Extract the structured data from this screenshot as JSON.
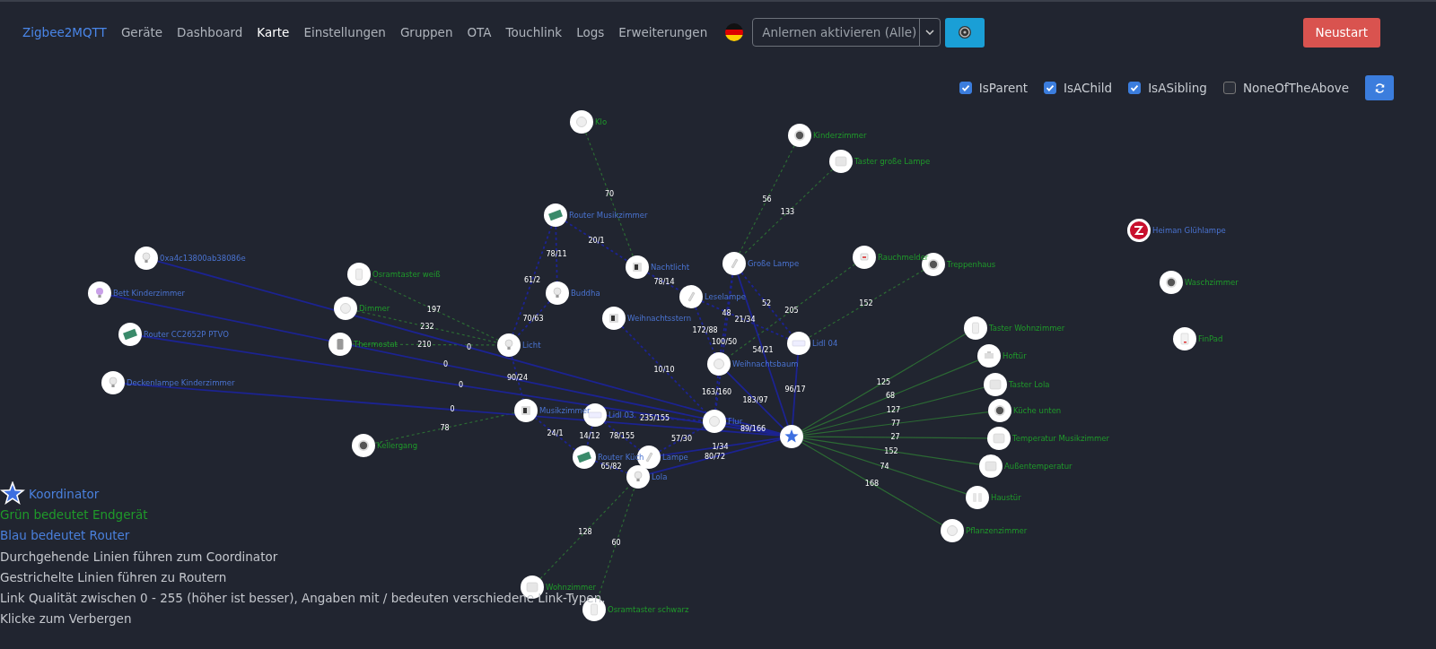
{
  "navbar": {
    "brand": "Zigbee2MQTT",
    "items": [
      {
        "label": "Geräte",
        "selected": false
      },
      {
        "label": "Dashboard",
        "selected": false
      },
      {
        "label": "Karte",
        "selected": true
      },
      {
        "label": "Einstellungen",
        "selected": false
      },
      {
        "label": "Gruppen",
        "selected": false
      },
      {
        "label": "OTA",
        "selected": false
      },
      {
        "label": "Touchlink",
        "selected": false
      },
      {
        "label": "Logs",
        "selected": false
      },
      {
        "label": "Erweiterungen",
        "selected": false
      }
    ],
    "permit_join": {
      "value": "Anlernen aktivieren (Alle)"
    },
    "restart_button": "Neustart"
  },
  "filters": [
    {
      "label": "IsParent",
      "checked": true
    },
    {
      "label": "IsAChild",
      "checked": true
    },
    {
      "label": "IsASibling",
      "checked": true
    },
    {
      "label": "NoneOfTheAbove",
      "checked": false
    }
  ],
  "map": {
    "nodes": [
      {
        "name": "Klo",
        "kind": "end_device"
      },
      {
        "name": "Kinderzimmer",
        "kind": "end_device"
      },
      {
        "name": "Taster große Lampe",
        "kind": "end_device"
      },
      {
        "name": "Router Musikzimmer",
        "kind": "router"
      },
      {
        "name": "Heiman Glühlampe",
        "kind": "router"
      },
      {
        "name": "0xa4c13800ab38086e",
        "kind": "router"
      },
      {
        "name": "Nachtlicht",
        "kind": "router"
      },
      {
        "name": "Große Lampe",
        "kind": "router"
      },
      {
        "name": "Rauchmelder",
        "kind": "end_device"
      },
      {
        "name": "Treppenhaus",
        "kind": "end_device"
      },
      {
        "name": "Osramtaster weiß",
        "kind": "end_device"
      },
      {
        "name": "Waschzimmer",
        "kind": "end_device"
      },
      {
        "name": "Bett Kinderzimmer",
        "kind": "router"
      },
      {
        "name": "Buddha",
        "kind": "router"
      },
      {
        "name": "Leselampe",
        "kind": "router"
      },
      {
        "name": "Dimmer",
        "kind": "end_device"
      },
      {
        "name": "Weihnachtsstern",
        "kind": "router"
      },
      {
        "name": "Router CC2652P PTVO",
        "kind": "router"
      },
      {
        "name": "Thermostat",
        "kind": "end_device"
      },
      {
        "name": "Licht",
        "kind": "router"
      },
      {
        "name": "Lidl 04",
        "kind": "router"
      },
      {
        "name": "Taster Wohnzimmer",
        "kind": "end_device"
      },
      {
        "name": "FinPad",
        "kind": "end_device"
      },
      {
        "name": "Weihnachtsbaum",
        "kind": "router"
      },
      {
        "name": "Hoftür",
        "kind": "end_device"
      },
      {
        "name": "Deckenlampe Kinderzimmer",
        "kind": "router"
      },
      {
        "name": "Taster Lola",
        "kind": "end_device"
      },
      {
        "name": "Musikzimmer",
        "kind": "router"
      },
      {
        "name": "Lidl 03",
        "kind": "router"
      },
      {
        "name": "Flur",
        "kind": "router"
      },
      {
        "name": "Küche unten",
        "kind": "end_device"
      },
      {
        "name": "Kellergang",
        "kind": "end_device"
      },
      {
        "kind": "coordinator"
      },
      {
        "name": "Temperatur Musikzimmer",
        "kind": "end_device"
      },
      {
        "name": "Router Küch",
        "kind": "router"
      },
      {
        "name": "Lampe",
        "kind": "router"
      },
      {
        "name": "Außentemperatur",
        "kind": "end_device"
      },
      {
        "name": "Lola",
        "kind": "router"
      },
      {
        "name": "Haustür",
        "kind": "end_device"
      },
      {
        "name": "Pflanzenzimmer",
        "kind": "end_device"
      },
      {
        "name": "Wohnzimmer",
        "kind": "end_device"
      },
      {
        "name": "Osramtaster schwarz",
        "kind": "end_device"
      }
    ],
    "links": [
      {
        "label": "125"
      },
      {
        "label": "68"
      },
      {
        "label": "127"
      },
      {
        "label": "77"
      },
      {
        "label": "27"
      },
      {
        "label": "152"
      },
      {
        "label": "74"
      },
      {
        "label": "168"
      },
      {
        "label": "70"
      },
      {
        "label": "56"
      },
      {
        "label": "133"
      },
      {
        "label": "205"
      },
      {
        "label": "152"
      },
      {
        "label": "197"
      },
      {
        "label": "232"
      },
      {
        "label": "210"
      },
      {
        "label": "78"
      },
      {
        "label": "128"
      },
      {
        "label": "60"
      },
      {
        "label": "0"
      },
      {
        "label": "0"
      },
      {
        "label": "0"
      },
      {
        "label": "0"
      },
      {
        "label": "96/17"
      },
      {
        "label": "183/97"
      },
      {
        "label": "89/166"
      },
      {
        "label": "54/21"
      },
      {
        "label": "1/34"
      },
      {
        "label": "80/72"
      },
      {
        "label": "20/1"
      },
      {
        "label": "78/11"
      },
      {
        "label": "61/2"
      },
      {
        "label": "52"
      },
      {
        "label": "21/34"
      },
      {
        "label": "90/24"
      },
      {
        "label": "24/1"
      },
      {
        "label": "14/12"
      },
      {
        "label": "65/82"
      },
      {
        "label": "163/160"
      },
      {
        "label": "57/30"
      },
      {
        "label": "70/63"
      },
      {
        "label": "78/14"
      },
      {
        "label": "48"
      },
      {
        "label": "172/88"
      },
      {
        "label": "100/50"
      },
      {
        "label": "10/10"
      },
      {
        "label": "235/155"
      },
      {
        "label": "78/155"
      }
    ]
  },
  "legend": [
    {
      "text": "Koordinator",
      "kind": "coordinator"
    },
    {
      "text": "Grün bedeutet Endgerät",
      "kind": "end_device"
    },
    {
      "text": "Blau bedeutet Router",
      "kind": "router"
    },
    {
      "text": "Durchgehende Linien führen zum Coordinator",
      "kind": "note"
    },
    {
      "text": "Gestrichelte Linien führen zu Routern",
      "kind": "note"
    },
    {
      "text": "Link Qualität zwischen 0 - 255 (höher ist besser), Angaben mit / bedeuten verschiedene Link-Typen.",
      "kind": "note"
    },
    {
      "text": "Klicke zum Verbergen",
      "kind": "note"
    }
  ]
}
